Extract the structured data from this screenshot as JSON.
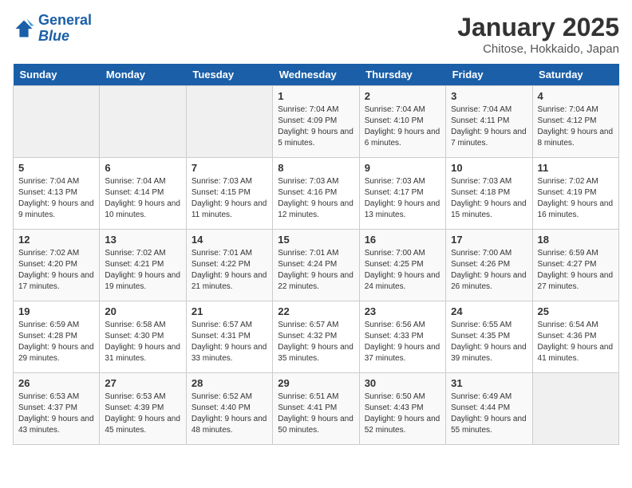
{
  "header": {
    "logo_line1": "General",
    "logo_line2": "Blue",
    "title": "January 2025",
    "subtitle": "Chitose, Hokkaido, Japan"
  },
  "weekdays": [
    "Sunday",
    "Monday",
    "Tuesday",
    "Wednesday",
    "Thursday",
    "Friday",
    "Saturday"
  ],
  "weeks": [
    [
      {
        "day": "",
        "empty": true
      },
      {
        "day": "",
        "empty": true
      },
      {
        "day": "",
        "empty": true
      },
      {
        "day": "1",
        "sunrise": "7:04 AM",
        "sunset": "4:09 PM",
        "daylight": "9 hours and 5 minutes."
      },
      {
        "day": "2",
        "sunrise": "7:04 AM",
        "sunset": "4:10 PM",
        "daylight": "9 hours and 6 minutes."
      },
      {
        "day": "3",
        "sunrise": "7:04 AM",
        "sunset": "4:11 PM",
        "daylight": "9 hours and 7 minutes."
      },
      {
        "day": "4",
        "sunrise": "7:04 AM",
        "sunset": "4:12 PM",
        "daylight": "9 hours and 8 minutes."
      }
    ],
    [
      {
        "day": "5",
        "sunrise": "7:04 AM",
        "sunset": "4:13 PM",
        "daylight": "9 hours and 9 minutes."
      },
      {
        "day": "6",
        "sunrise": "7:04 AM",
        "sunset": "4:14 PM",
        "daylight": "9 hours and 10 minutes."
      },
      {
        "day": "7",
        "sunrise": "7:03 AM",
        "sunset": "4:15 PM",
        "daylight": "9 hours and 11 minutes."
      },
      {
        "day": "8",
        "sunrise": "7:03 AM",
        "sunset": "4:16 PM",
        "daylight": "9 hours and 12 minutes."
      },
      {
        "day": "9",
        "sunrise": "7:03 AM",
        "sunset": "4:17 PM",
        "daylight": "9 hours and 13 minutes."
      },
      {
        "day": "10",
        "sunrise": "7:03 AM",
        "sunset": "4:18 PM",
        "daylight": "9 hours and 15 minutes."
      },
      {
        "day": "11",
        "sunrise": "7:02 AM",
        "sunset": "4:19 PM",
        "daylight": "9 hours and 16 minutes."
      }
    ],
    [
      {
        "day": "12",
        "sunrise": "7:02 AM",
        "sunset": "4:20 PM",
        "daylight": "9 hours and 17 minutes."
      },
      {
        "day": "13",
        "sunrise": "7:02 AM",
        "sunset": "4:21 PM",
        "daylight": "9 hours and 19 minutes."
      },
      {
        "day": "14",
        "sunrise": "7:01 AM",
        "sunset": "4:22 PM",
        "daylight": "9 hours and 21 minutes."
      },
      {
        "day": "15",
        "sunrise": "7:01 AM",
        "sunset": "4:24 PM",
        "daylight": "9 hours and 22 minutes."
      },
      {
        "day": "16",
        "sunrise": "7:00 AM",
        "sunset": "4:25 PM",
        "daylight": "9 hours and 24 minutes."
      },
      {
        "day": "17",
        "sunrise": "7:00 AM",
        "sunset": "4:26 PM",
        "daylight": "9 hours and 26 minutes."
      },
      {
        "day": "18",
        "sunrise": "6:59 AM",
        "sunset": "4:27 PM",
        "daylight": "9 hours and 27 minutes."
      }
    ],
    [
      {
        "day": "19",
        "sunrise": "6:59 AM",
        "sunset": "4:28 PM",
        "daylight": "9 hours and 29 minutes."
      },
      {
        "day": "20",
        "sunrise": "6:58 AM",
        "sunset": "4:30 PM",
        "daylight": "9 hours and 31 minutes."
      },
      {
        "day": "21",
        "sunrise": "6:57 AM",
        "sunset": "4:31 PM",
        "daylight": "9 hours and 33 minutes."
      },
      {
        "day": "22",
        "sunrise": "6:57 AM",
        "sunset": "4:32 PM",
        "daylight": "9 hours and 35 minutes."
      },
      {
        "day": "23",
        "sunrise": "6:56 AM",
        "sunset": "4:33 PM",
        "daylight": "9 hours and 37 minutes."
      },
      {
        "day": "24",
        "sunrise": "6:55 AM",
        "sunset": "4:35 PM",
        "daylight": "9 hours and 39 minutes."
      },
      {
        "day": "25",
        "sunrise": "6:54 AM",
        "sunset": "4:36 PM",
        "daylight": "9 hours and 41 minutes."
      }
    ],
    [
      {
        "day": "26",
        "sunrise": "6:53 AM",
        "sunset": "4:37 PM",
        "daylight": "9 hours and 43 minutes."
      },
      {
        "day": "27",
        "sunrise": "6:53 AM",
        "sunset": "4:39 PM",
        "daylight": "9 hours and 45 minutes."
      },
      {
        "day": "28",
        "sunrise": "6:52 AM",
        "sunset": "4:40 PM",
        "daylight": "9 hours and 48 minutes."
      },
      {
        "day": "29",
        "sunrise": "6:51 AM",
        "sunset": "4:41 PM",
        "daylight": "9 hours and 50 minutes."
      },
      {
        "day": "30",
        "sunrise": "6:50 AM",
        "sunset": "4:43 PM",
        "daylight": "9 hours and 52 minutes."
      },
      {
        "day": "31",
        "sunrise": "6:49 AM",
        "sunset": "4:44 PM",
        "daylight": "9 hours and 55 minutes."
      },
      {
        "day": "",
        "empty": true
      }
    ]
  ]
}
